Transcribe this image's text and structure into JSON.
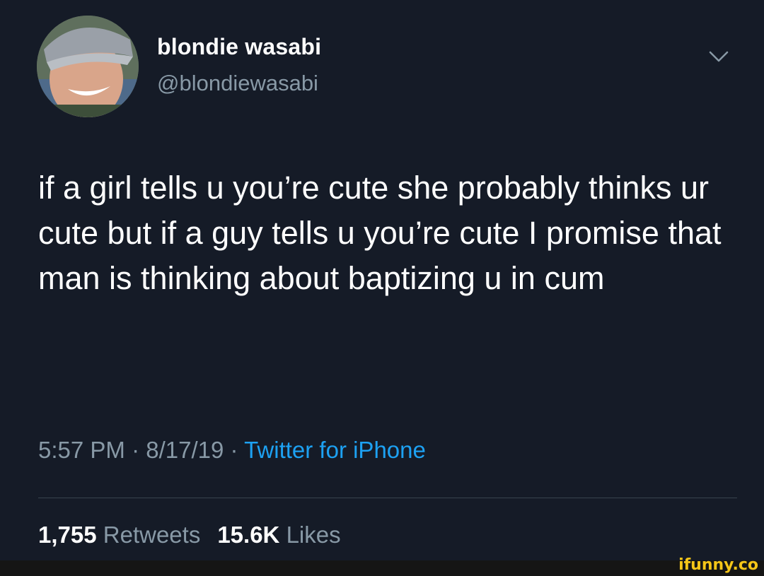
{
  "tweet": {
    "display_name": "blondie wasabi",
    "handle": "@blondiewasabi",
    "text": "if a girl tells u you’re cute she probably thinks ur cute but if a guy tells u you’re cute I promise that man is thinking about baptizing u in cum",
    "time": "5:57 PM",
    "separator": " · ",
    "date": "8/17/19",
    "source": "Twitter for iPhone",
    "retweets_count": "1,755",
    "retweets_label": "Retweets",
    "likes_count": "15.6K",
    "likes_label": "Likes"
  },
  "icons": {
    "menu": "chevron-down-icon",
    "avatar": "avatar-photo"
  },
  "colors": {
    "background": "#151b27",
    "secondary_text": "#8899a6",
    "link": "#1da1f2",
    "watermark": "#f5c518"
  },
  "watermark": "ifunny.co"
}
